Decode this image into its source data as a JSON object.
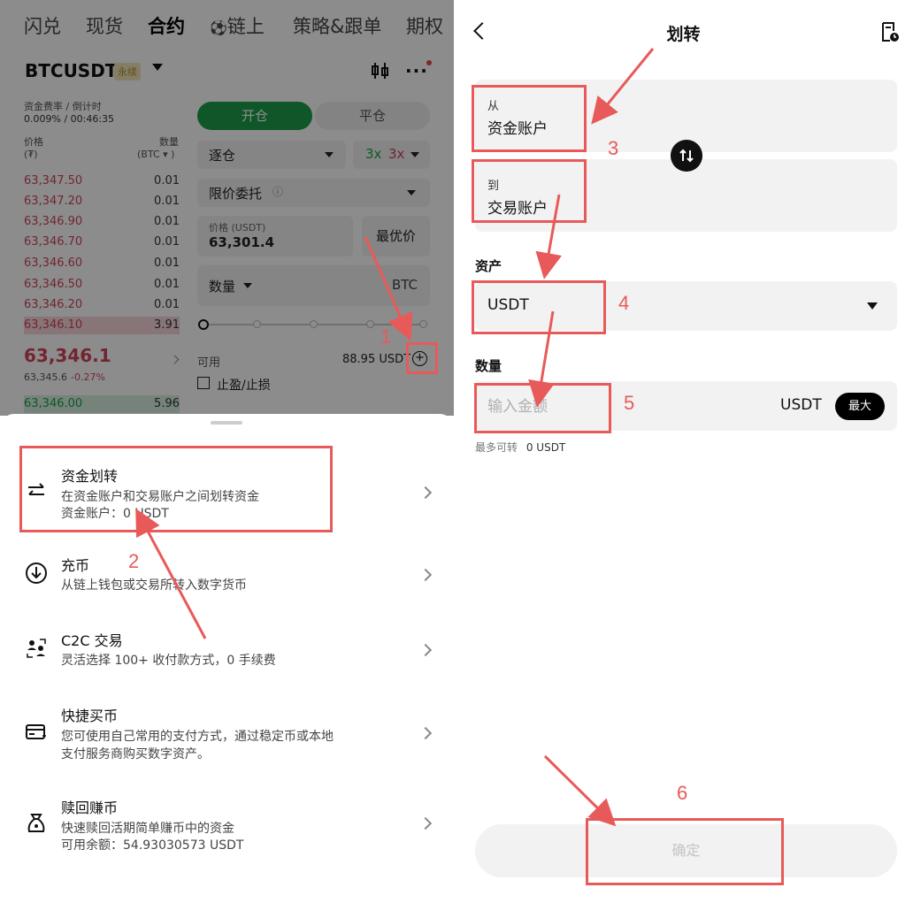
{
  "left": {
    "nav_tabs": [
      "闪兑",
      "现货",
      "合约",
      "链上",
      "策略&跟单",
      "期权"
    ],
    "symbol": "BTCUSDT",
    "badge": "永续",
    "funding_label": "资金费率 / 倒计时",
    "funding_value": "0.009% / 00:46:35",
    "price_header": "价格",
    "price_unit": "(₮)",
    "qty_header": "数量",
    "qty_unit": "(BTC ▾ )",
    "asks": [
      {
        "price": "63,347.50",
        "qty": "0.01"
      },
      {
        "price": "63,347.20",
        "qty": "0.01"
      },
      {
        "price": "63,346.90",
        "qty": "0.01"
      },
      {
        "price": "63,346.70",
        "qty": "0.01"
      },
      {
        "price": "63,346.60",
        "qty": "0.01"
      },
      {
        "price": "63,346.50",
        "qty": "0.01"
      },
      {
        "price": "63,346.20",
        "qty": "0.01"
      },
      {
        "price": "63,346.10",
        "qty": "3.91"
      }
    ],
    "last_price": "63,346.1",
    "last_sub": "63,345.6",
    "last_change": "-0.27%",
    "bid_price": "63,346.00",
    "bid_qty": "5.96",
    "tab_open": "开仓",
    "tab_close": "平仓",
    "margin_mode": "逐仓",
    "leverage_long": "3x",
    "leverage_short": "3x",
    "order_type": "限价委托",
    "price_input_label": "价格 (USDT)",
    "price_input_value": "63,301.4",
    "best_price": "最优价",
    "qty_label": "数量",
    "qty_unit_btc": "BTC",
    "avail_label": "可用",
    "avail_value": "88.95 USDT",
    "tpsl_label": "止盈/止损",
    "sheet_items": [
      {
        "title": "资金划转",
        "sub1": "在资金账户和交易账户之间划转资金",
        "sub2": "资金账户：0 USDT"
      },
      {
        "title": "充币",
        "sub1": "从链上钱包或交易所转入数字货币",
        "sub2": ""
      },
      {
        "title": "C2C 交易",
        "sub1": "灵活选择 100+ 收付款方式，0 手续费",
        "sub2": ""
      },
      {
        "title": "快捷买币",
        "sub1": "您可使用自己常用的支付方式，通过稳定币或本地",
        "sub2": "支付服务商购买数字资产。"
      },
      {
        "title": "赎回赚币",
        "sub1": "快速赎回活期简单赚币中的资金",
        "sub2": "可用余额：54.93030573 USDT"
      }
    ]
  },
  "right": {
    "title": "划转",
    "from_label": "从",
    "from_value": "资金账户",
    "to_label": "到",
    "to_value": "交易账户",
    "asset_label": "资产",
    "asset_value": "USDT",
    "amount_label": "数量",
    "amount_placeholder": "输入金额",
    "amount_unit": "USDT",
    "max_label": "最大",
    "max_hint_label": "最多可转",
    "max_hint_value": "0 USDT",
    "confirm_label": "确定"
  },
  "annotations": [
    "1",
    "2",
    "3",
    "4",
    "5",
    "6"
  ],
  "colors": {
    "accent_red": "#e85a5a",
    "buy_green": "#1d9e4a",
    "sell_red": "#d0445a"
  }
}
